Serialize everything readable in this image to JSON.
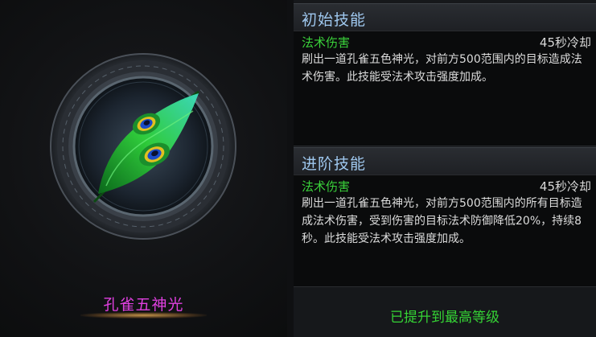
{
  "skill": {
    "name": "孔雀五神光",
    "icon": "peacock-feather-icon"
  },
  "initial_skill": {
    "header": "初始技能",
    "damage_type": "法术伤害",
    "cooldown": "45秒冷却",
    "description": "刷出一道孔雀五色神光，对前方500范围内的目标造成法术伤害。此技能受法术攻击强度加成。"
  },
  "advanced_skill": {
    "header": "进阶技能",
    "damage_type": "法术伤害",
    "cooldown": "45秒冷却",
    "description": "刷出一道孔雀五色神光，对前方500范围内的所有目标造成法术伤害，受到伤害的目标法术防御降低20%，持续8秒。此技能受法术攻击强度加成。"
  },
  "status": {
    "max_level_text": "已提升到最高等级"
  },
  "colors": {
    "header_text": "#9fc8ef",
    "damage_type_text": "#3ad23a",
    "skill_name_text": "#e040e0",
    "max_level_text": "#35d335"
  }
}
